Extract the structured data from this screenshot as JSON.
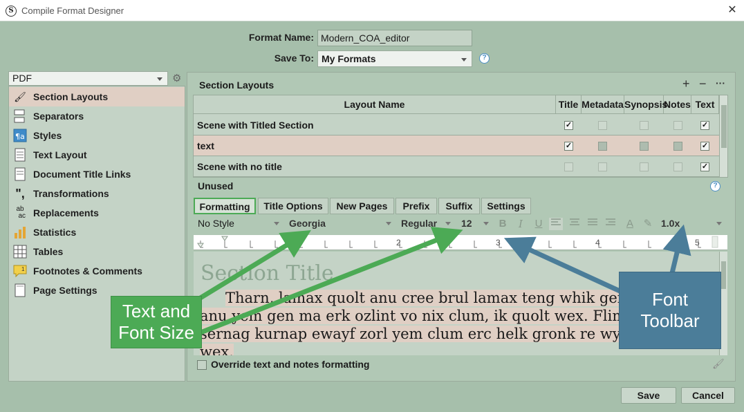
{
  "window": {
    "title": "Compile Format Designer",
    "close_label": "✕"
  },
  "form": {
    "format_name_label": "Format Name:",
    "format_name_value": "Modern_COA_editor",
    "save_to_label": "Save To:",
    "save_to_value": "My Formats"
  },
  "compile_for": {
    "value": "PDF"
  },
  "sidebar": {
    "items": [
      {
        "label": "Section Layouts",
        "icon": "pen-icon"
      },
      {
        "label": "Separators",
        "icon": "separator-icon"
      },
      {
        "label": "Styles",
        "icon": "paragraph-style-icon"
      },
      {
        "label": "Text Layout",
        "icon": "document-icon"
      },
      {
        "label": "Document Title Links",
        "icon": "document-links-icon"
      },
      {
        "label": "Transformations",
        "icon": "quotes-icon"
      },
      {
        "label": "Replacements",
        "icon": "ab-ac-icon"
      },
      {
        "label": "Statistics",
        "icon": "bar-chart-icon"
      },
      {
        "label": "Tables",
        "icon": "table-icon"
      },
      {
        "label": "Footnotes & Comments",
        "icon": "footnote-icon"
      },
      {
        "label": "Page Settings",
        "icon": "page-icon"
      }
    ]
  },
  "section_layouts": {
    "title": "Section Layouts",
    "add_label": "+",
    "remove_label": "−",
    "more_label": "···",
    "columns": [
      "Layout Name",
      "Title",
      "Metadata",
      "Synopsis",
      "Notes",
      "Text"
    ],
    "rows": [
      {
        "name": "Scene with Titled Section",
        "flags": [
          "checked",
          "empty",
          "empty",
          "empty",
          "checked"
        ]
      },
      {
        "name": "text",
        "flags": [
          "checked",
          "gray",
          "gray",
          "gray",
          "checked"
        ]
      },
      {
        "name": "Scene with no title",
        "flags": [
          "empty",
          "empty",
          "empty",
          "empty",
          "checked"
        ]
      }
    ],
    "unused_label": "Unused"
  },
  "tabs": [
    "Formatting",
    "Title Options",
    "New Pages",
    "Prefix",
    "Suffix",
    "Settings"
  ],
  "font_toolbar": {
    "style": "No Style",
    "font": "Georgia",
    "weight": "Regular",
    "size": "12",
    "bold": "B",
    "italic": "I",
    "underline": "U",
    "line_spacing": "1.0x"
  },
  "ruler": {
    "labels": [
      "2",
      "3",
      "4",
      "5"
    ]
  },
  "editor": {
    "section_title": "Section Title",
    "lines": [
      "Tharn, lamax quolt anu cree brul lamax teng whik gen",
      "anu yem gen ma erk ozlint vo nix clum, ik quolt wex. Flim",
      "sernag kurnap ewayf zorl yem clum erc helk gronk re wyn",
      "wex."
    ]
  },
  "override": {
    "label": "Override text and notes formatting"
  },
  "buttons": {
    "save": "Save",
    "cancel": "Cancel"
  },
  "callouts": {
    "left": [
      "Text and",
      "Font Size"
    ],
    "right": [
      "Font",
      "Toolbar"
    ]
  },
  "colors": {
    "callout_green": "#4caa55",
    "callout_blue": "#4b7d99",
    "selection": "#e0cfc4"
  }
}
